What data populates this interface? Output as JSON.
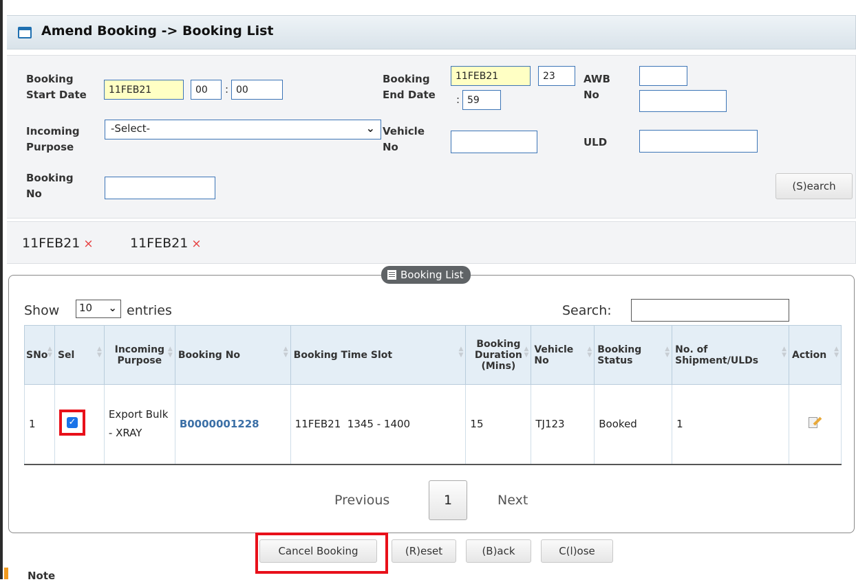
{
  "title": "Amend Booking -> Booking List",
  "search_form": {
    "booking_start_date_label": "Booking\nStart Date",
    "start_date": "11FEB21",
    "start_hour": "00",
    "start_minute": "00",
    "booking_end_date_label": "Booking\nEnd Date",
    "end_date": "11FEB21",
    "end_hour": "23",
    "end_minute": "59",
    "awb_no_label": "AWB\nNo",
    "awb_prefix": "",
    "awb_number": "",
    "incoming_purpose_label": "Incoming\nPurpose",
    "incoming_purpose_value": "-Select-",
    "vehicle_no_label": "Vehicle\nNo",
    "vehicle_no": "",
    "uld_label": "ULD",
    "uld_value": "",
    "booking_no_label": "Booking\nNo",
    "booking_no": "",
    "search_button": "(S)earch"
  },
  "filters": [
    {
      "label": "11FEB21",
      "remove": "×"
    },
    {
      "label": "11FEB21",
      "remove": "×"
    }
  ],
  "list": {
    "legend": "Booking List",
    "show_label": "Show",
    "entries_count": "10",
    "entries_label": "entries",
    "search_label": "Search:",
    "columns": [
      "SNo",
      "Sel",
      "Incoming Purpose",
      "Booking No",
      "Booking Time Slot",
      "Booking Duration (Mins)",
      "Vehicle No",
      "Booking Status",
      "No. of Shipment/ULDs",
      "Action"
    ],
    "rows": [
      {
        "sno": "1",
        "selected": true,
        "incoming_purpose": "Export Bulk - XRAY",
        "booking_no": "B0000001228",
        "time_slot": "11FEB21  1345 - 1400",
        "duration": "15",
        "vehicle_no": "TJ123",
        "status": "Booked",
        "shipments": "1"
      }
    ],
    "pagination": {
      "previous": "Previous",
      "current_page": "1",
      "next": "Next"
    }
  },
  "buttons": {
    "cancel_booking": "Cancel Booking",
    "reset": "(R)eset",
    "back": "(B)ack",
    "close": "C(l)ose"
  },
  "note_label": "Note",
  "colors": {
    "highlight": "#e8101a",
    "accent": "#3b74b6",
    "date_bg": "#ffffc4"
  }
}
